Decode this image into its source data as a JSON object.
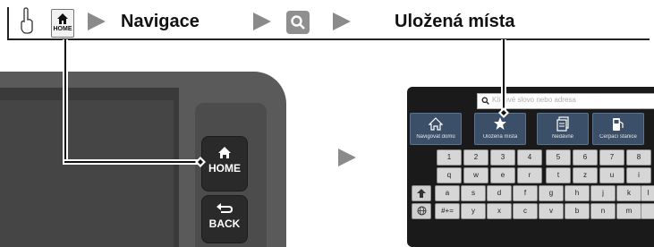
{
  "header": {
    "step1": "Navigace",
    "step2": "Uložená místa",
    "home_icon_label": "HOME"
  },
  "device": {
    "home_button_label": "HOME",
    "back_button_label": "BACK"
  },
  "nav_screen": {
    "search_placeholder": "Klíčové slovo nebo adresa",
    "tiles": [
      "Navigovat domů",
      "Uložená místa",
      "Nedávné",
      "Čerpací stanice"
    ],
    "keyboard_rows": [
      [
        "1",
        "2",
        "3",
        "4",
        "5",
        "6",
        "7",
        "8"
      ],
      [
        "q",
        "w",
        "e",
        "r",
        "t",
        "z",
        "u",
        "i"
      ],
      [
        "a",
        "s",
        "d",
        "f",
        "g",
        "h",
        "j",
        "k",
        "l"
      ],
      [
        "#+=",
        "y",
        "x",
        "c",
        "v",
        "b",
        "n",
        "m"
      ]
    ]
  }
}
